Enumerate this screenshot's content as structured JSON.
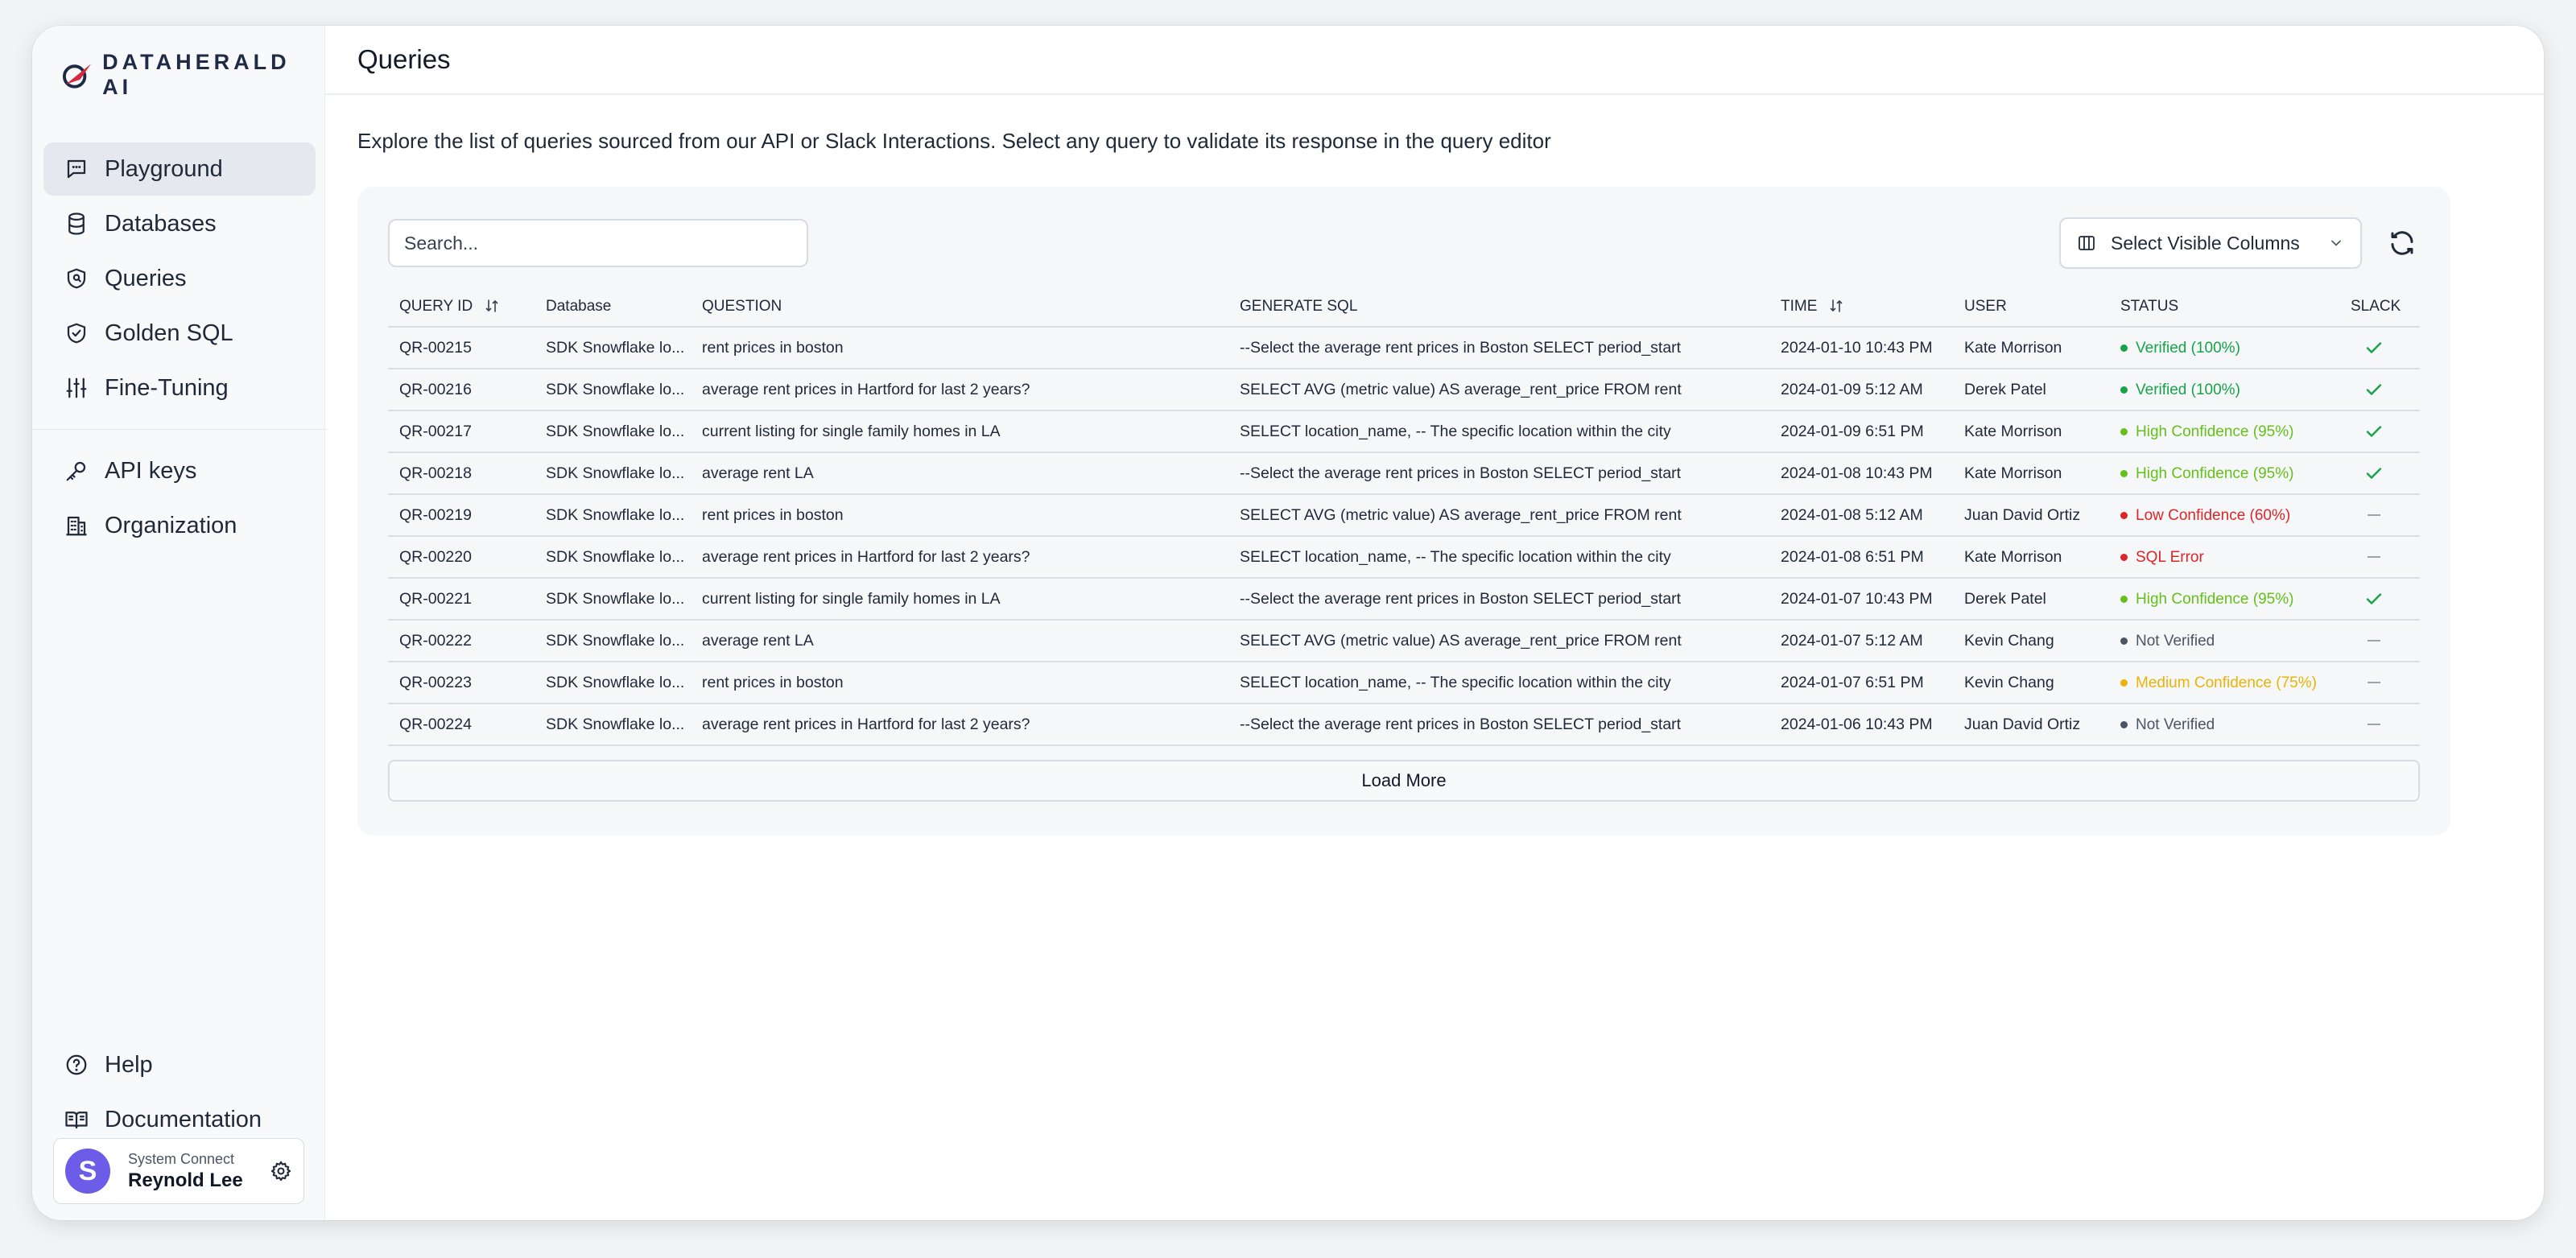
{
  "brand": {
    "name": "DATAHERALD AI"
  },
  "sidebar": {
    "items": [
      {
        "label": "Playground",
        "icon": "chat-icon",
        "active": true
      },
      {
        "label": "Databases",
        "icon": "database-icon"
      },
      {
        "label": "Queries",
        "icon": "shield-icon"
      },
      {
        "label": "Golden SQL",
        "icon": "shield-check-icon"
      },
      {
        "label": "Fine-Tuning",
        "icon": "sliders-icon"
      }
    ],
    "secondary": [
      {
        "label": "API keys",
        "icon": "key-icon"
      },
      {
        "label": "Organization",
        "icon": "building-icon"
      }
    ],
    "bottom": [
      {
        "label": "Help",
        "icon": "help-icon"
      },
      {
        "label": "Documentation",
        "icon": "book-icon"
      }
    ],
    "user": {
      "initial": "S",
      "org": "System Connect",
      "name": "Reynold Lee"
    }
  },
  "header": {
    "title": "Queries"
  },
  "main": {
    "description": "Explore the list of queries sourced from our API or Slack Interactions. Select any query to validate its response in the query editor",
    "search": {
      "placeholder": "Search..."
    },
    "columns_select": {
      "label": "Select Visible Columns"
    },
    "load_more": "Load More",
    "table": {
      "headers": {
        "query_id": "QUERY ID",
        "database": "Database",
        "question": "QUESTION",
        "sql": "GENERATE SQL",
        "time": "TIME",
        "user": "USER",
        "status": "STATUS",
        "slack": "SLACK"
      },
      "rows": [
        {
          "id": "QR-00215",
          "database": "SDK Snowflake lo...",
          "question": "rent prices in boston",
          "sql": "--Select the average rent prices in Boston SELECT period_start",
          "time": "2024-01-10 10:43 PM",
          "user": "Kate Morrison",
          "status": "Verified (100%)",
          "status_color": "#16a34a",
          "slack": true
        },
        {
          "id": "QR-00216",
          "database": "SDK Snowflake lo...",
          "question": "average rent prices in Hartford for last 2 years?",
          "sql": "SELECT AVG (metric value) AS average_rent_price FROM rent",
          "time": "2024-01-09 5:12 AM",
          "user": "Derek Patel",
          "status": "Verified (100%)",
          "status_color": "#16a34a",
          "slack": true
        },
        {
          "id": "QR-00217",
          "database": "SDK Snowflake lo...",
          "question": "current listing for single family homes in LA",
          "sql": "SELECT location_name, -- The specific location within the city",
          "time": "2024-01-09 6:51 PM",
          "user": "Kate Morrison",
          "status": "High Confidence (95%)",
          "status_color": "#65c01a",
          "slack": true
        },
        {
          "id": "QR-00218",
          "database": "SDK Snowflake lo...",
          "question": "average rent LA",
          "sql": "--Select the average rent prices in Boston SELECT period_start",
          "time": "2024-01-08 10:43 PM",
          "user": "Kate Morrison",
          "status": "High Confidence (95%)",
          "status_color": "#65c01a",
          "slack": true
        },
        {
          "id": "QR-00219",
          "database": "SDK Snowflake lo...",
          "question": "rent prices in boston",
          "sql": "SELECT AVG (metric value) AS average_rent_price FROM rent",
          "time": "2024-01-08 5:12 AM",
          "user": "Juan David Ortiz",
          "status": "Low Confidence (60%)",
          "status_color": "#dc2626",
          "slack": false
        },
        {
          "id": "QR-00220",
          "database": "SDK Snowflake lo...",
          "question": "average rent prices in Hartford for last 2 years?",
          "sql": "SELECT location_name, -- The specific location within the city",
          "time": "2024-01-08 6:51 PM",
          "user": "Kate Morrison",
          "status": "SQL Error",
          "status_color": "#dc2626",
          "slack": false
        },
        {
          "id": "QR-00221",
          "database": "SDK Snowflake lo...",
          "question": "current listing for single family homes in LA",
          "sql": "--Select the average rent prices in Boston SELECT period_start",
          "time": "2024-01-07 10:43 PM",
          "user": "Derek Patel",
          "status": "High Confidence (95%)",
          "status_color": "#65c01a",
          "slack": true
        },
        {
          "id": "QR-00222",
          "database": "SDK Snowflake lo...",
          "question": "average rent LA",
          "sql": "SELECT AVG (metric value) AS average_rent_price FROM rent",
          "time": "2024-01-07 5:12 AM",
          "user": "Kevin Chang",
          "status": "Not Verified",
          "status_color": "#4b5563",
          "slack": false
        },
        {
          "id": "QR-00223",
          "database": "SDK Snowflake lo...",
          "question": "rent prices in boston",
          "sql": "SELECT location_name, -- The specific location within the city",
          "time": "2024-01-07 6:51 PM",
          "user": "Kevin Chang",
          "status": "Medium Confidence (75%)",
          "status_color": "#eab308",
          "slack": false
        },
        {
          "id": "QR-00224",
          "database": "SDK Snowflake lo...",
          "question": "average rent prices in Hartford for last 2 years?",
          "sql": "--Select the average rent prices in Boston SELECT period_start",
          "time": "2024-01-06 10:43 PM",
          "user": "Juan David Ortiz",
          "status": "Not Verified",
          "status_color": "#4b5563",
          "slack": false
        }
      ]
    }
  },
  "colors": {
    "accent": "#6d5ce8",
    "brand_red": "#d6293e",
    "brand_navy": "#1f2a44",
    "check": "#16a34a"
  }
}
